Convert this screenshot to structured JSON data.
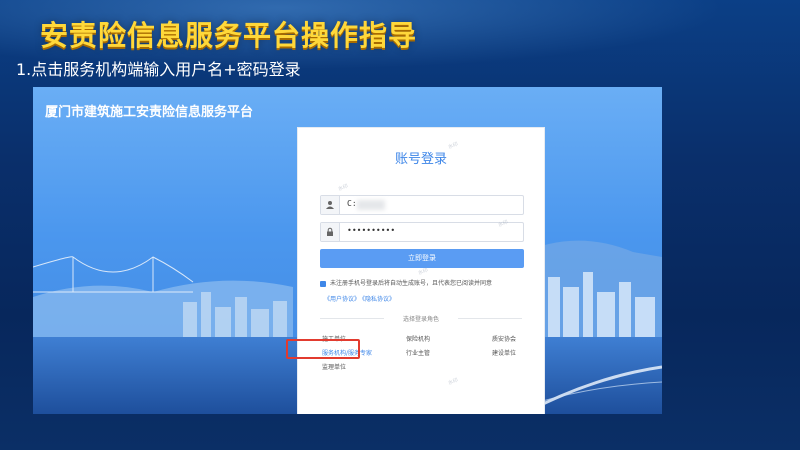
{
  "slide": {
    "title": "安责险信息服务平台操作指导",
    "step": "1.点击服务机构端输入用户名+密码登录"
  },
  "site": {
    "title": "厦门市建筑施工安责险信息服务平台"
  },
  "login": {
    "title": "账号登录",
    "username_value": "C:",
    "password_value": "••••••••••",
    "submit_label": "立即登录",
    "agreement_text": "未注册手机号登录后将自动生成账号，且代表您已阅读并同意",
    "links": [
      "《用户协议》",
      "《隐私协议》"
    ],
    "role_heading": "选择登录角色",
    "roles": {
      "construction_unit": "施工单位",
      "insurer": "保险机构",
      "safety_association": "质安协会",
      "service_agency": "服务机构/服务专家",
      "authority": "行业主管",
      "builder": "建设单位",
      "supervisor": "监理单位"
    },
    "watermark": "水印"
  },
  "colors": {
    "title_yellow": "#ffd83a",
    "accent_blue": "#3f87e8",
    "button_blue": "#5a9cf3",
    "highlight_red": "#e23b2f"
  },
  "icons": {
    "username": "user-icon",
    "password": "lock-icon",
    "agree": "checkbox-checked-icon"
  }
}
